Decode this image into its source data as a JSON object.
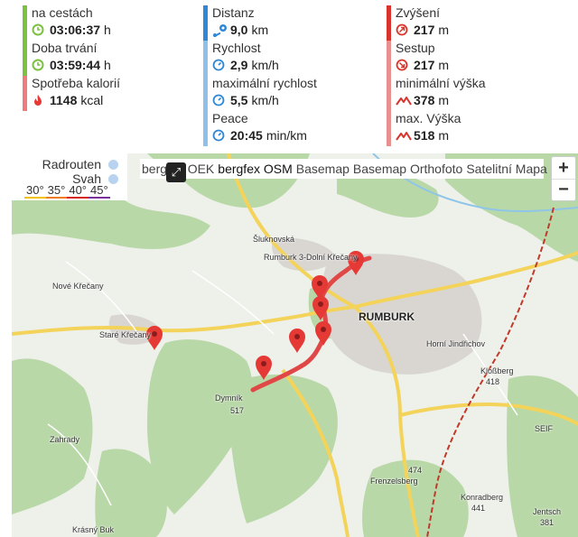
{
  "stats": {
    "col1": [
      {
        "label": "na cestách",
        "value": "03:06:37",
        "unit": "h",
        "icon": "clock-icon",
        "color": "#7cc142"
      },
      {
        "label": "Doba trvání",
        "value": "03:59:44",
        "unit": "h",
        "icon": "clock-icon",
        "color": "#7cc142"
      },
      {
        "label": "Spotřeba kalorií",
        "value": "1148",
        "unit": "kcal",
        "icon": "flame-icon",
        "color": "#ee7c7c"
      }
    ],
    "col2": [
      {
        "label": "Distanz",
        "value": "9,0",
        "unit": "km",
        "icon": "route-pin-icon",
        "color": "#2f87d6"
      },
      {
        "label": "Rychlost",
        "value": "2,9",
        "unit": "km/h",
        "icon": "speedometer-icon",
        "color": "#8fc0ea"
      },
      {
        "label": "maximální rychlost",
        "value": "5,5",
        "unit": "km/h",
        "icon": "speedometer-icon",
        "color": "#8fc0ea"
      },
      {
        "label": "Peace",
        "value": "20:45",
        "unit": "min/km",
        "icon": "speedometer-icon",
        "color": "#8fc0ea"
      }
    ],
    "col3": [
      {
        "label": "Zvýšení",
        "value": "217",
        "unit": "m",
        "icon": "ascent-icon",
        "color": "#d9342b"
      },
      {
        "label": "Sestup",
        "value": "217",
        "unit": "m",
        "icon": "descent-icon",
        "color": "#e88f8f"
      },
      {
        "label": "minimální výška",
        "value": "378",
        "unit": "m",
        "icon": "mountain-icon",
        "color": "#e88f8f"
      },
      {
        "label": "max. Výška",
        "value": "518",
        "unit": "m",
        "icon": "mountain-icon",
        "color": "#e88f8f"
      }
    ]
  },
  "legend": {
    "radrouten": "Radrouten",
    "svah": "Svah",
    "slopes": [
      {
        "label": "30°",
        "color": "#f2c200"
      },
      {
        "label": "35°",
        "color": "#f07a1a"
      },
      {
        "label": "40°",
        "color": "#d9261c"
      },
      {
        "label": "45°",
        "color": "#7a2f9a"
      }
    ]
  },
  "layers": {
    "items": [
      "bergfex",
      "OEK",
      "bergfex OSM",
      "Basemap",
      "Basemap Orthofoto",
      "Satelitní Mapa"
    ],
    "active": "bergfex OSM"
  },
  "zoom": {
    "in": "+",
    "out": "−"
  },
  "map": {
    "labels": [
      {
        "text": "Rumburk 3-Dolní Křečany",
        "big": false
      },
      {
        "text": "RUMBURK",
        "big": true
      },
      {
        "text": "Nové Křečany",
        "big": false
      },
      {
        "text": "Staré Křečany",
        "big": false
      },
      {
        "text": "Dymník",
        "big": false
      },
      {
        "text": "517",
        "big": false
      },
      {
        "text": "Horní Jindřichov",
        "big": false
      },
      {
        "text": "Kloßberg",
        "big": false
      },
      {
        "text": "418",
        "big": false
      },
      {
        "text": "Frenzelsberg",
        "big": false
      },
      {
        "text": "474",
        "big": false
      },
      {
        "text": "Zahrady",
        "big": false
      },
      {
        "text": "Krásný Buk",
        "big": false
      },
      {
        "text": "Konradberg",
        "big": false
      },
      {
        "text": "441",
        "big": false
      },
      {
        "text": "Jentsch",
        "big": false
      },
      {
        "text": "381",
        "big": false
      },
      {
        "text": "SEIF",
        "big": false
      },
      {
        "text": "Šluknovská",
        "big": false
      }
    ],
    "colors": {
      "track": "#e04848",
      "forest": "#b9d8a8",
      "road": "#f3d35a",
      "pin": "#e53935"
    }
  }
}
